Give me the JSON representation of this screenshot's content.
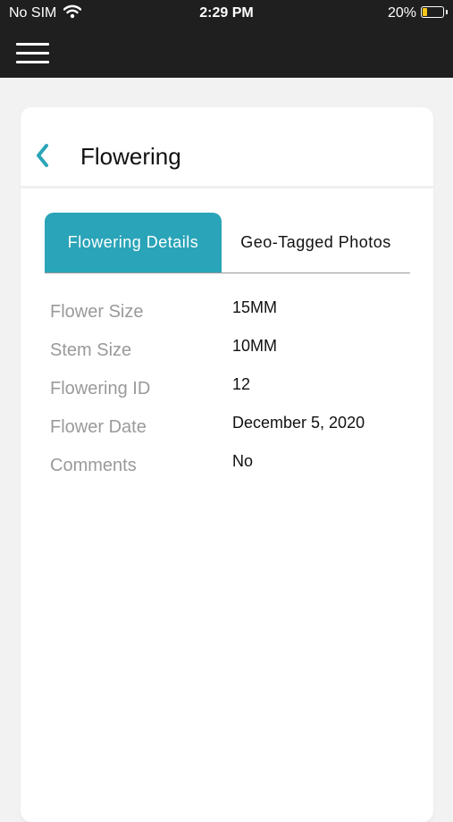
{
  "status_bar": {
    "carrier": "No SIM",
    "time": "2:29 PM",
    "battery": "20%",
    "battery_level": 0.2,
    "battery_color": "#f5c518"
  },
  "nav": {
    "menu_icon": "hamburger-menu-icon"
  },
  "card": {
    "back_icon": "chevron-left-icon",
    "title": "Flowering"
  },
  "tabs": [
    {
      "label": "Flowering Details",
      "active": true
    },
    {
      "label": "Geo-Tagged Photos",
      "active": false
    }
  ],
  "details": [
    {
      "label": "Flower Size",
      "value": "15MM"
    },
    {
      "label": "Stem Size",
      "value": "10MM"
    },
    {
      "label": "Flowering ID",
      "value": "12"
    },
    {
      "label": "Flower Date",
      "value": "December 5, 2020"
    },
    {
      "label": "Comments",
      "value": "No"
    }
  ],
  "colors": {
    "accent": "#2aa4b8",
    "topbar": "#1f1f1f"
  }
}
